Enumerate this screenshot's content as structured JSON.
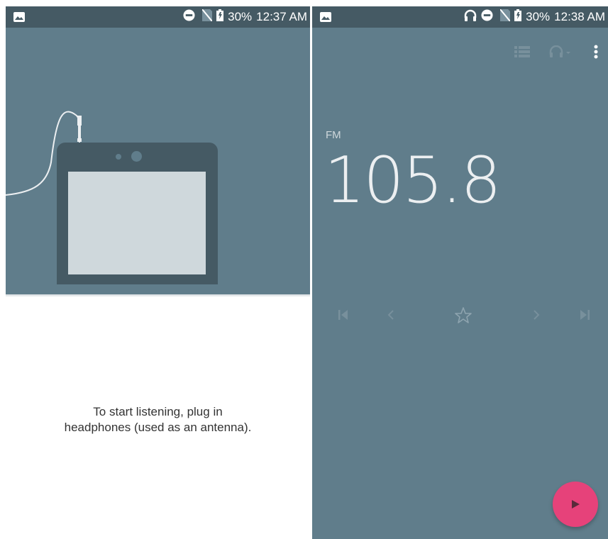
{
  "left_screen": {
    "statusbar": {
      "battery": "30%",
      "time": "12:37 AM",
      "icons": [
        "image-icon",
        "do-not-disturb-icon",
        "no-sim-icon",
        "battery-icon"
      ]
    },
    "message_line1": "To start listening, plug in",
    "message_line2": "headphones (used as an antenna)."
  },
  "right_screen": {
    "statusbar": {
      "battery": "30%",
      "time": "12:38 AM",
      "icons": [
        "image-icon",
        "headphones-icon",
        "do-not-disturb-icon",
        "no-sim-icon",
        "battery-icon"
      ]
    },
    "toolbar": {
      "icons": [
        "station-list-icon",
        "audio-output-headphones-icon",
        "more-options-icon"
      ]
    },
    "band": "FM",
    "frequency": "105.8",
    "controls": [
      "seek-previous-icon",
      "tune-down-icon",
      "favorite-star-icon",
      "tune-up-icon",
      "seek-next-icon"
    ],
    "play_button": "play-icon"
  },
  "colors": {
    "statusbar": "#455a64",
    "background": "#607d8b",
    "accent": "#e6427a"
  }
}
